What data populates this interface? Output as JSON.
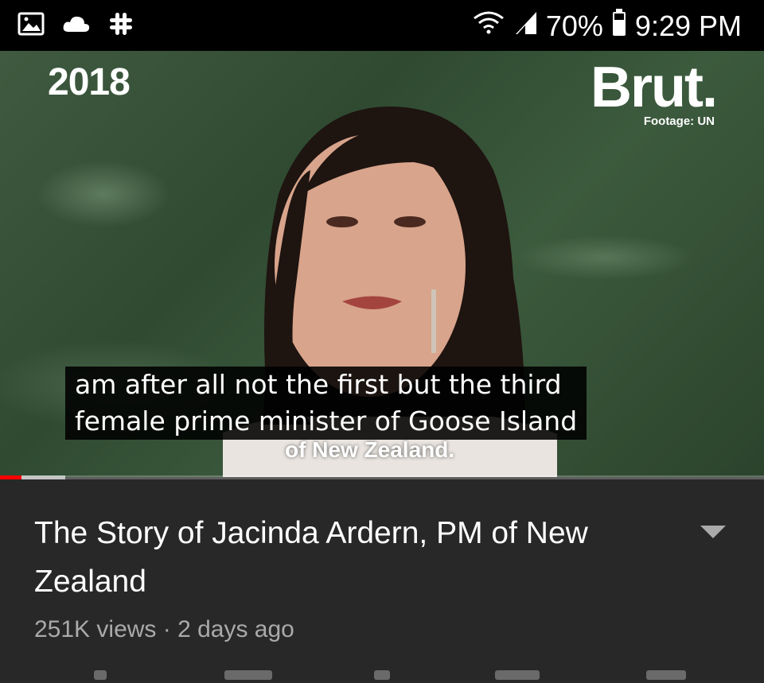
{
  "status_bar": {
    "icons_left": [
      "gallery-icon",
      "cloud-icon",
      "slack-icon"
    ],
    "icons_right": [
      "wifi-icon",
      "signal-icon",
      "battery-icon"
    ],
    "battery_percent": "70%",
    "time": "9:29 PM"
  },
  "video": {
    "year_overlay": "2018",
    "brand_logo": "Brut.",
    "footage_credit": "Footage: UN",
    "captions": [
      "am after all not the first but the third",
      "female prime minister of Goose Island"
    ],
    "burned_subtitle": "of New Zealand.",
    "progress": {
      "played_fraction": 0.028,
      "buffered_fraction": 0.085,
      "played_color": "#ff0000"
    }
  },
  "details": {
    "title": "The Story of Jacinda Ardern, PM of New Zealand",
    "meta": "251K views · 2 days ago",
    "expand_icon": "chevron-down-icon"
  }
}
